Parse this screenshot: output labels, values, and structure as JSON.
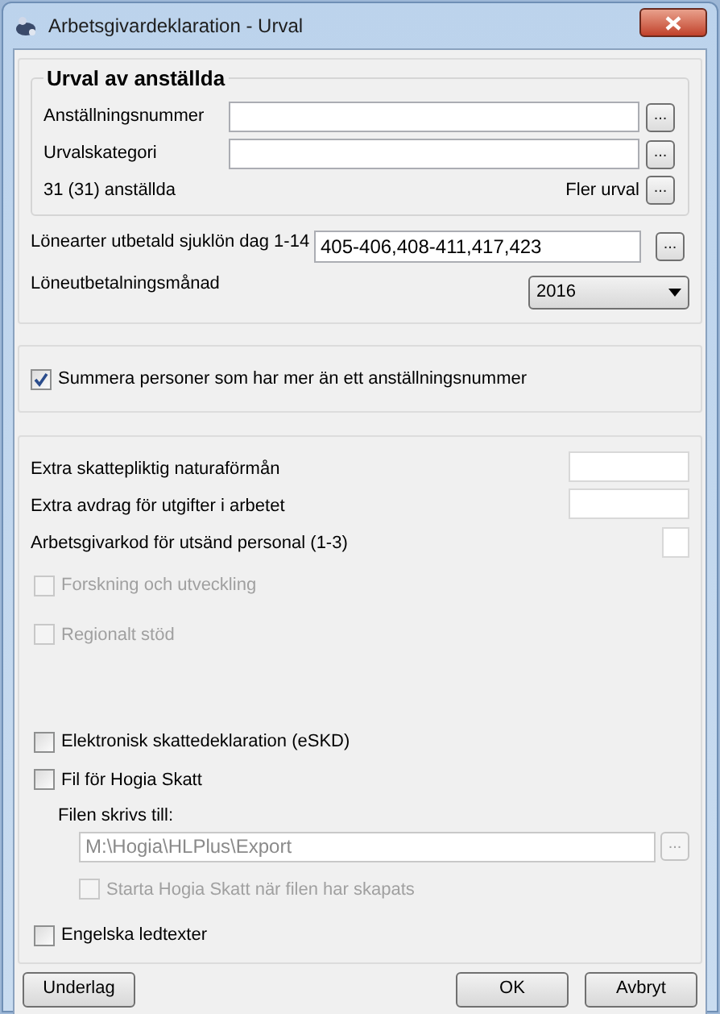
{
  "window": {
    "title": "Arbetsgivardeklaration - Urval"
  },
  "selection_group": {
    "title": "Urval av anställda",
    "fields": [
      {
        "label": "Anställningsnummer",
        "browse": "..."
      },
      {
        "label": "Urvalskategori",
        "browse": "..."
      }
    ],
    "count": "31 (31) anställda",
    "more": {
      "label": "Fler urval",
      "browse": "..."
    }
  },
  "wage_types": {
    "label": "Lönearter utbetald sjuklön dag 1-14",
    "value": "405-406,408-411,417,423",
    "browse": "..."
  },
  "month": {
    "label": "Löneutbetalningsmånad",
    "value": "2016"
  },
  "summarize": {
    "label": "Summera personer som har mer än ett anställningsnummer",
    "checked": true
  },
  "extra_fields": [
    {
      "label": "Extra skattepliktig naturaförmån",
      "kind": "wide"
    },
    {
      "label": "Extra avdrag för utgifter i arbetet",
      "kind": "wide"
    },
    {
      "label": "Arbetsgivarkod för utsänd personal  (1-3)",
      "kind": "narrow"
    }
  ],
  "options": [
    {
      "label": "Forskning och utveckling",
      "checked": false,
      "disabled": true
    },
    {
      "label": "Regionalt stöd",
      "checked": false,
      "disabled": true
    }
  ],
  "export_options": [
    {
      "label": "Elektronisk skattedeklaration (eSKD)",
      "checked": false,
      "disabled": false
    },
    {
      "label": "Fil för Hogia Skatt",
      "checked": false,
      "disabled": false
    }
  ],
  "file": {
    "label": "Filen skrivs till:",
    "value": "M:\\Hogia\\HLPlus\\Export",
    "browse": "...",
    "disabled": true
  },
  "start_skatt": {
    "label": "Starta Hogia Skatt när filen har skapats",
    "checked": false,
    "disabled": true
  },
  "english": {
    "label": "Engelska ledtexter",
    "checked": false,
    "disabled": false
  },
  "buttons": [
    {
      "label": "Underlag"
    },
    {
      "label": "OK"
    },
    {
      "label": "Avbryt"
    }
  ]
}
